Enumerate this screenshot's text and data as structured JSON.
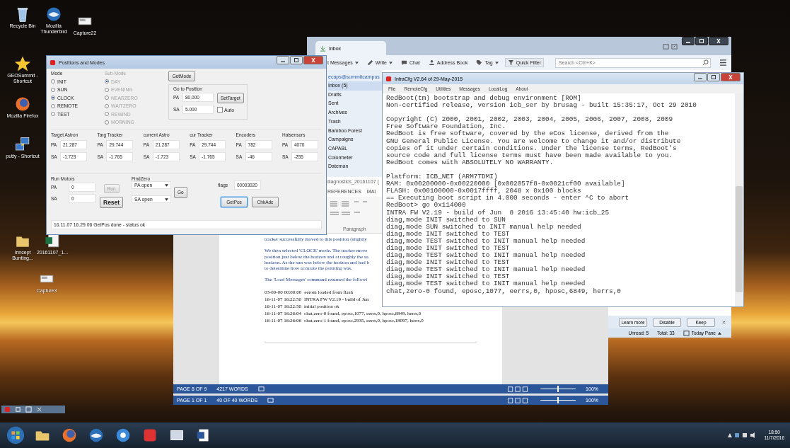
{
  "desktop_icons": [
    {
      "label": "Recycle Bin",
      "kind": "bin"
    },
    {
      "label": "Mozilla Thunderbird",
      "kind": "mail"
    },
    {
      "label": "Capture22",
      "kind": "image"
    },
    {
      "label": "GEOSummit - Shortcut",
      "kind": "star"
    },
    {
      "label": "Mozilla Firefox",
      "kind": "browser"
    },
    {
      "label": "putty - Shortcut",
      "kind": "terminal"
    },
    {
      "label": "Inncept Bunting...",
      "kind": "folder"
    },
    {
      "label": "20161107_1...",
      "kind": "sheet"
    },
    {
      "label": "Capture3",
      "kind": "image"
    }
  ],
  "mail_window": {
    "tab": "Inbox",
    "toolbar": [
      {
        "label": "t Messages",
        "dropdown": true
      },
      {
        "label": "Write",
        "dropdown": true
      },
      {
        "label": "Chat",
        "dropdown": false
      },
      {
        "label": "Address Book",
        "dropdown": false
      },
      {
        "label": "Tag",
        "dropdown": true
      },
      {
        "label": "Quick Filter",
        "dropdown": false
      }
    ],
    "search_placeholder": "Search <Ctrl+K>",
    "account": "ecaps@summitcampus",
    "folders": [
      {
        "label": "Inbox (5)",
        "selected": true
      },
      {
        "label": "Drafts",
        "selected": false
      },
      {
        "label": "Sent",
        "selected": false
      },
      {
        "label": "Archives",
        "selected": false
      },
      {
        "label": "Trash",
        "selected": false
      },
      {
        "label": "Bamboo Forest",
        "selected": false
      },
      {
        "label": "Campaigns",
        "selected": false
      },
      {
        "label": "CAPABL",
        "selected": false
      },
      {
        "label": "Colormeter",
        "selected": false
      },
      {
        "label": "Dateman",
        "selected": false
      }
    ],
    "notification_buttons": [
      "Learn more",
      "Disable",
      "Keep"
    ],
    "unread": "Unread: 5",
    "total": "Total: 33",
    "today_pane": "Today Pane"
  },
  "document_window": {
    "title": "diagnostics_20161107 (",
    "ribbon_tabs": [
      "REFERENCES",
      "MAI"
    ],
    "ribbon_group": "Paragraph",
    "paragraphs": [
      [
        "tracker successfully moved to this position (slightly"
      ],
      [
        "We then selected 'CLOCK' mode. The tracker move",
        "position just below the horizon and at roughly the sa",
        "horizon. As the sun was below the horizon and had b",
        "to determine how accurate the pointing was."
      ],
      [
        "The 'Load Messages' command returned the followi"
      ]
    ],
    "log_lines": [
      {
        "time": "03-00-00 00:00:00",
        "text": "eerom loaded from flash"
      },
      {
        "time": "16-11-07 16:22:50",
        "text": "INTRA FW V2.19 - build of Jun"
      },
      {
        "time": "16-11-07 16:22:50",
        "text": "initial position ok"
      },
      {
        "time": "16-11-07 16:26:04",
        "text": "chat,zero-0 found, eposc,1077, eerrs,0, hposc,6849, herrs,0"
      },
      {
        "time": "16-11-07 16:26:06",
        "text": "chat,zero-1 found, eposc,2935, eerrs,0, hposc,18097, herrs,0"
      }
    ],
    "status": {
      "page": "PAGE 8 OF 9",
      "words": "4217 WORDS",
      "zoom": "100%",
      "level": 0.5
    }
  },
  "document_window_behind": {
    "status": {
      "page": "PAGE 1 OF 1",
      "words": "40 OF 40 WORDS",
      "zoom": "100%",
      "level": 0.5
    }
  },
  "terminal_window": {
    "title": "IntraCfg V2.64 of 29-May-2015",
    "menu": [
      "File",
      "RemoteCfg",
      "Utilities",
      "Messages",
      "LocalLog",
      "About"
    ],
    "blocks": [
      [
        "RedBoot(tm) bootstrap and debug environment [ROM]",
        "Non-certified release, version icb_ser by brusag - built 15:35:17, Oct 29 2010"
      ],
      [
        "Copyright (C) 2000, 2001, 2002, 2003, 2004, 2005, 2006, 2007, 2008, 2009",
        "Free Software Foundation, Inc.",
        "RedBoot is free software, covered by the eCos license, derived from the",
        "GNU General Public License. You are welcome to change it and/or distribute",
        "copies of it under certain conditions. Under the license terms, RedBoot's",
        "source code and full license terms must have been made available to you.",
        "RedBoot comes with ABSOLUTELY NO WARRANTY."
      ],
      [
        "Platform: ICB_NET (ARM7TDMI)",
        "RAM: 0x00200000-0x00220000 [0x002057f8-0x0021cf00 available]",
        "FLASH: 0x00100000-0x0017ffff, 2048 x 0x100 blocks",
        "== Executing boot script in 4.000 seconds - enter ^C to abort",
        "RedBoot> go 0x114000",
        "INTRA FW V2.19 - build of Jun  8 2016 13:45:40 hw:icb_25",
        "diag,mode INIT switched to SUN",
        "diag,mode SUN switched to INIT manual help needed",
        "diag,mode INIT switched to TEST",
        "diag,mode TEST switched to INIT manual help needed",
        "diag,mode INIT switched to TEST",
        "diag,mode TEST switched to INIT manual help needed",
        "diag,mode INIT switched to TEST",
        "diag,mode TEST switched to INIT manual help needed",
        "diag,mode INIT switched to TEST",
        "diag,mode TEST switched to INIT manual help needed",
        "chat,zero-0 found, eposc,1077, eerrs,0, hposc,6849, herrs,0"
      ]
    ]
  },
  "positions_window": {
    "title": "Positions and Modes",
    "mode_label": "Mode",
    "modes": [
      {
        "label": "INIT",
        "selected": false
      },
      {
        "label": "SUN",
        "selected": false
      },
      {
        "label": "CLOCK",
        "selected": true
      },
      {
        "label": "REMOTE",
        "selected": false
      },
      {
        "label": "TEST",
        "selected": false
      }
    ],
    "submode_label": "Sub-Mode",
    "submodes_disabled": true,
    "submodes": [
      {
        "label": "DAY",
        "selected": true
      },
      {
        "label": "EVENING",
        "selected": false
      },
      {
        "label": "NEARZERO",
        "selected": false
      },
      {
        "label": "WAITZERO",
        "selected": false
      },
      {
        "label": "REWIND",
        "selected": false
      },
      {
        "label": "MORNING",
        "selected": false
      }
    ],
    "getmode_button": "GetMode",
    "goto": {
      "title": "Go to Position",
      "fields": [
        {
          "label": "PA",
          "value": "80.000"
        },
        {
          "label": "SA",
          "value": "5.000"
        }
      ],
      "set_button": "SetTarget",
      "auto": {
        "label": "Auto",
        "checked": false
      }
    },
    "groups": [
      {
        "title": "Target Astron",
        "fields": [
          {
            "label": "PA",
            "value": "21.287"
          },
          {
            "label": "SA",
            "value": "-1.723"
          }
        ]
      },
      {
        "title": "Targ Tracker",
        "fields": [
          {
            "label": "PA",
            "value": "29.744"
          },
          {
            "label": "SA",
            "value": "-1.765"
          }
        ]
      },
      {
        "title": "current Astro",
        "fields": [
          {
            "label": "PA",
            "value": "21.287"
          },
          {
            "label": "SA",
            "value": "-1.723"
          }
        ]
      },
      {
        "title": "cur Tracker",
        "fields": [
          {
            "label": "PA",
            "value": "29.744"
          },
          {
            "label": "SA",
            "value": "-1.765"
          }
        ]
      },
      {
        "title": "Encoders",
        "fields": [
          {
            "label": "PA",
            "value": "782"
          },
          {
            "label": "SA",
            "value": "-46"
          }
        ]
      },
      {
        "title": "Halsensors",
        "fields": [
          {
            "label": "PA",
            "value": "4070"
          },
          {
            "label": "SA",
            "value": "-255"
          }
        ]
      }
    ],
    "run_motors": {
      "title": "Run Motors",
      "fields": [
        {
          "label": "PA",
          "value": "0"
        },
        {
          "label": "SA",
          "value": "0"
        }
      ],
      "run_button": {
        "label": "Run",
        "disabled": true
      },
      "reset_button": "Reset"
    },
    "find_zero": {
      "title": "FindZero",
      "dropdowns": [
        "PA open",
        "SA open"
      ],
      "go_button": "Go"
    },
    "flags": {
      "label": "flags",
      "value": "00003020"
    },
    "buttons": [
      {
        "label": "GetPos",
        "focused": true
      },
      {
        "label": "ChkAdc",
        "focused": false
      }
    ],
    "status": "16.11.07 16.29.06 GetPos done - status ok"
  },
  "taskbar": {
    "time": "18:50",
    "date": "11/7/2016"
  }
}
